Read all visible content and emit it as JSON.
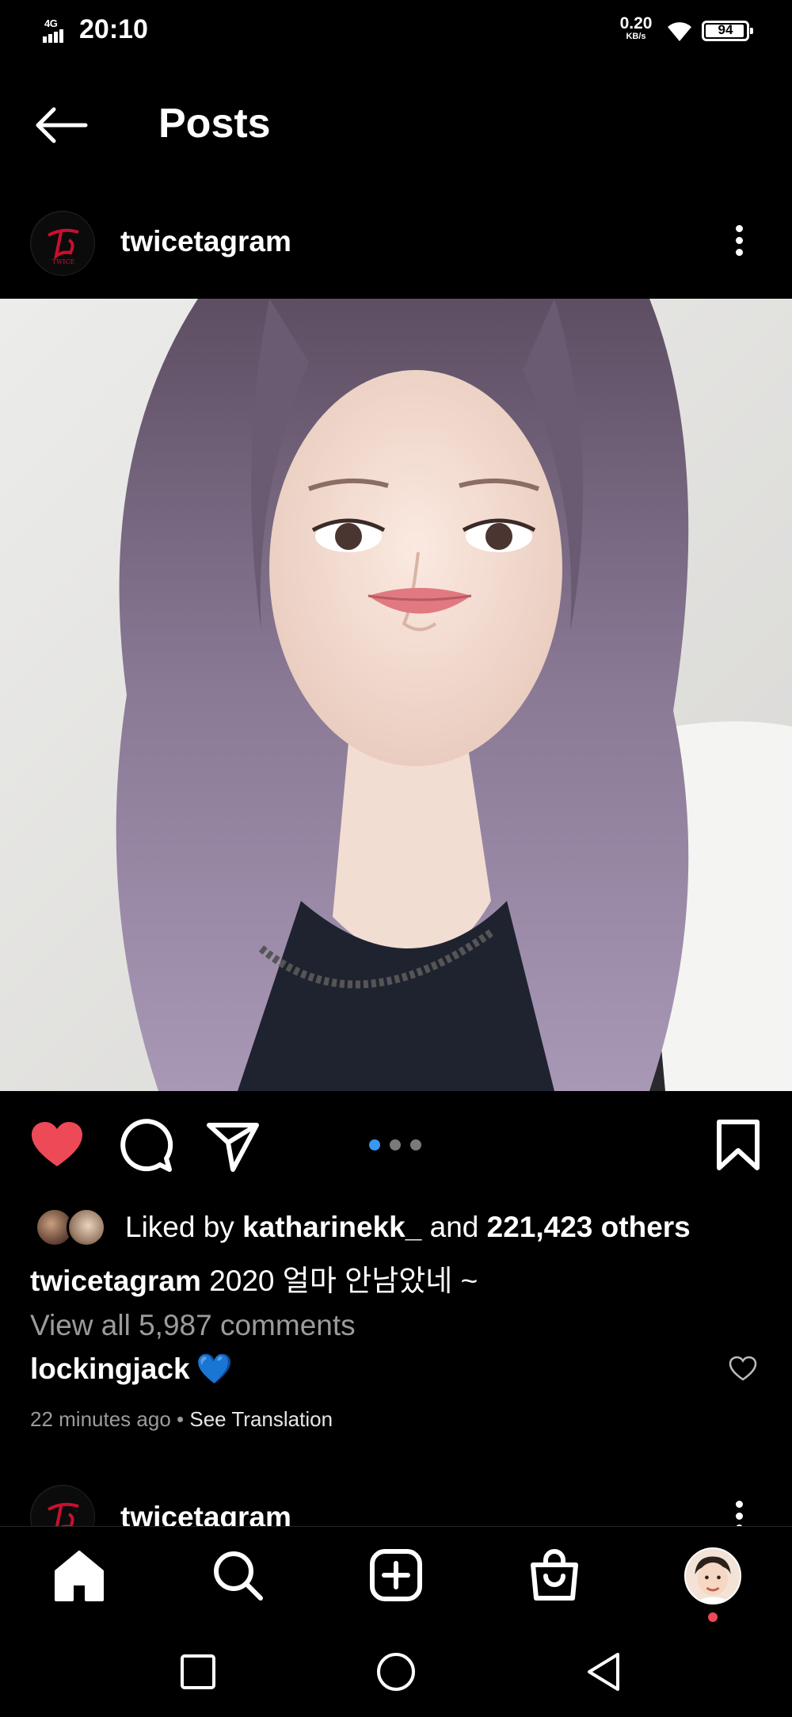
{
  "status_bar": {
    "network": "4G",
    "time": "20:10",
    "speed_value": "0.20",
    "speed_unit": "KB/s",
    "battery": "94"
  },
  "header": {
    "title": "Posts",
    "back_icon": "arrow-left-icon"
  },
  "post": {
    "username": "twicetagram",
    "likes_prefix": "Liked by ",
    "liked_by": "katharinekk_",
    "likes_and": " and ",
    "likes_count": "221,423 others",
    "caption_user": "twicetagram",
    "caption_text": " 2020 얼마 안남았네 ~",
    "view_comments": "View all 5,987 comments",
    "comment_user": "lockingjack",
    "comment_emoji": "💙",
    "time_ago": "22 minutes ago",
    "separator": " • ",
    "see_translation": "See Translation",
    "carousel_total": 3,
    "carousel_active": 1,
    "liked": true
  },
  "next_post": {
    "username": "twicetagram"
  },
  "bottom_nav": {
    "items": [
      "home-icon",
      "search-icon",
      "add-post-icon",
      "shop-icon",
      "profile-avatar"
    ]
  },
  "colors": {
    "like_red": "#ed4956",
    "carousel_active_blue": "#3897f0"
  }
}
